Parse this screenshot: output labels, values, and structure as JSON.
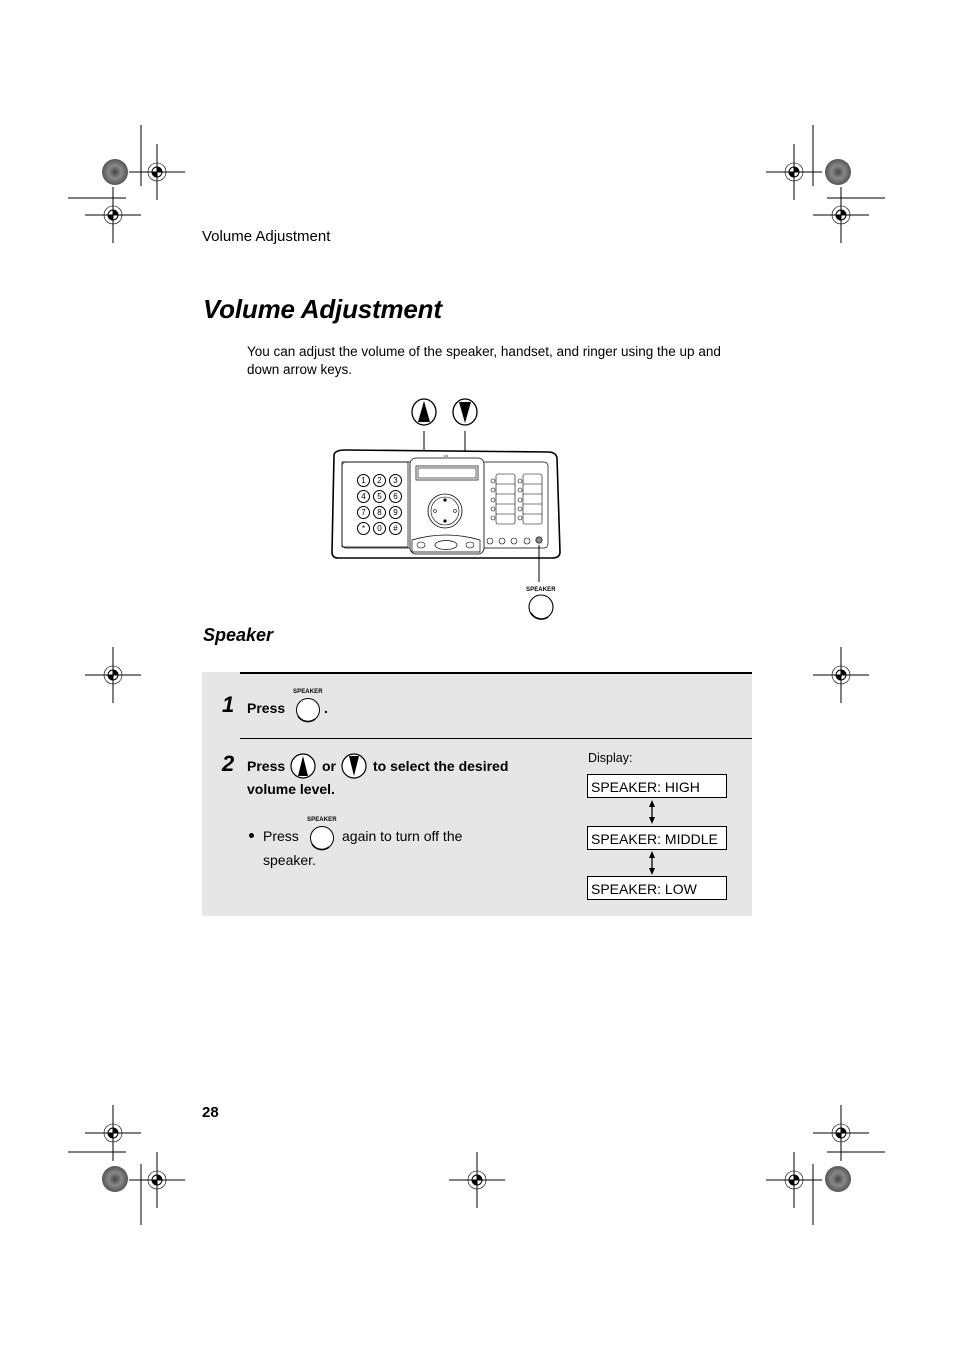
{
  "running_head": "Volume Adjustment",
  "page_title": "Volume Adjustment",
  "intro_text": "You can adjust the volume of the speaker, handset, and ringer using the up and down arrow keys.",
  "illustration": {
    "keypad_keys": [
      "1",
      "2",
      "3",
      "4",
      "5",
      "6",
      "7",
      "8",
      "9",
      "*",
      "0",
      "#"
    ],
    "speaker_label": "SPEAKER"
  },
  "section_title": "Speaker",
  "steps": [
    {
      "number": "1",
      "press_label": "Press",
      "key_label": "SPEAKER",
      "trailing": "."
    },
    {
      "number": "2",
      "press_label": "Press",
      "or_label": "or",
      "rest_line1": "to select the desired",
      "rest_line2": "volume level.",
      "bullet": {
        "press_label": "Press",
        "key_label": "SPEAKER",
        "rest_line1": "again to turn off the",
        "rest_line2": "speaker."
      }
    }
  ],
  "display": {
    "label": "Display:",
    "levels": [
      "SPEAKER: HIGH",
      "SPEAKER: MIDDLE",
      "SPEAKER: LOW"
    ]
  },
  "page_number": "28"
}
